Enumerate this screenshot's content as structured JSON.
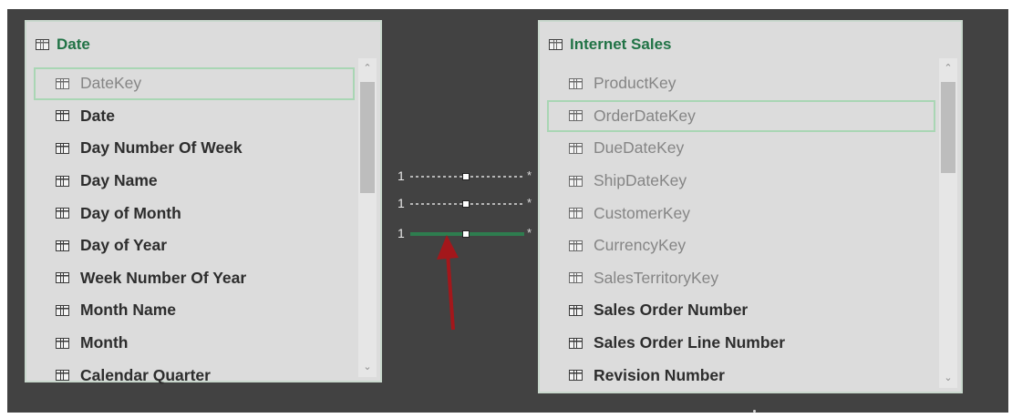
{
  "date_table": {
    "title": "Date",
    "fields": [
      {
        "name": "DateKey",
        "hidden": true,
        "selected": true
      },
      {
        "name": "Date",
        "hidden": false
      },
      {
        "name": "Day Number Of Week",
        "hidden": false
      },
      {
        "name": "Day Name",
        "hidden": false
      },
      {
        "name": "Day of Month",
        "hidden": false
      },
      {
        "name": "Day of Year",
        "hidden": false
      },
      {
        "name": "Week Number Of Year",
        "hidden": false
      },
      {
        "name": "Month Name",
        "hidden": false
      },
      {
        "name": "Month",
        "hidden": false
      },
      {
        "name": "Calendar Quarter",
        "hidden": false
      }
    ]
  },
  "sales_table": {
    "title": "Internet Sales",
    "fields": [
      {
        "name": "ProductKey",
        "hidden": true
      },
      {
        "name": "OrderDateKey",
        "hidden": true,
        "selected": true
      },
      {
        "name": "DueDateKey",
        "hidden": true
      },
      {
        "name": "ShipDateKey",
        "hidden": true
      },
      {
        "name": "CustomerKey",
        "hidden": true
      },
      {
        "name": "CurrencyKey",
        "hidden": true
      },
      {
        "name": "SalesTerritoryKey",
        "hidden": true
      },
      {
        "name": "Sales Order Number",
        "hidden": false
      },
      {
        "name": "Sales Order Line Number",
        "hidden": false
      },
      {
        "name": "Revision Number",
        "hidden": false
      }
    ]
  },
  "relationships": [
    {
      "from_cardinality": "1",
      "to_cardinality": "*",
      "active": false
    },
    {
      "from_cardinality": "1",
      "to_cardinality": "*",
      "active": false
    },
    {
      "from_cardinality": "1",
      "to_cardinality": "*",
      "active": true
    }
  ],
  "colors": {
    "canvas": "#424242",
    "card": "#dcdcdc",
    "title": "#217346",
    "active_line": "#2e7d4f",
    "selection": "#a9d6b4",
    "annotation_arrow": "#a3171b"
  },
  "icons": {
    "table": "table-icon",
    "column": "table-icon",
    "scroll_up": "scroll-up-icon",
    "scroll_down": "scroll-down-icon",
    "annotation": "red-arrow-icon"
  }
}
